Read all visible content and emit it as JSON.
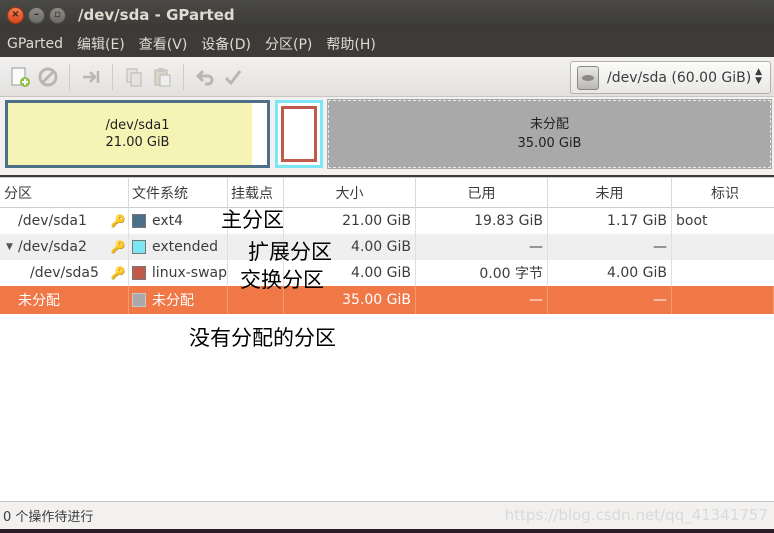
{
  "window": {
    "title": "/dev/sda - GParted",
    "close_glyph": "×",
    "min_glyph": "–",
    "max_glyph": "▫"
  },
  "menu": [
    "GParted",
    "编辑(E)",
    "查看(V)",
    "设备(D)",
    "分区(P)",
    "帮助(H)"
  ],
  "toolbar": {
    "icons": [
      "new-partition-icon",
      "delete-icon",
      "resize-move-icon",
      "copy-icon",
      "paste-icon",
      "undo-icon",
      "apply-icon"
    ],
    "device_selector": "/dev/sda   (60.00 GiB)"
  },
  "map": {
    "sda1_label": "/dev/sda1",
    "sda1_size": "21.00 GiB",
    "sda1_used_fraction": 0.944,
    "unalloc_label": "未分配",
    "unalloc_size": "35.00 GiB"
  },
  "table": {
    "headers": [
      "分区",
      "文件系统",
      "挂载点",
      "大小",
      "已用",
      "未用",
      "标识"
    ],
    "rows": [
      {
        "partition": "/dev/sda1",
        "filesystem": "ext4",
        "color": "#4d6f88",
        "mount": "",
        "size": "21.00 GiB",
        "used": "19.83 GiB",
        "unused": "1.17 GiB",
        "flags": "boot"
      },
      {
        "partition": "/dev/sda2",
        "filesystem": "extended",
        "color": "#7de6f3",
        "mount": "",
        "size": "4.00 GiB",
        "used": "—",
        "unused": "—",
        "flags": ""
      },
      {
        "partition": "/dev/sda5",
        "filesystem": "linux-swap",
        "color": "#c15a4b",
        "mount": "",
        "size": "4.00 GiB",
        "used": "0.00 字节",
        "unused": "4.00 GiB",
        "flags": ""
      },
      {
        "partition": "未分配",
        "filesystem": "未分配",
        "color": "#a9a9a9",
        "mount": "",
        "size": "35.00 GiB",
        "used": "—",
        "unused": "—",
        "flags": ""
      }
    ]
  },
  "annotations": {
    "primary": "主分区",
    "extended": "扩展分区",
    "swap": "交换分区",
    "unallocated": "没有分配的分区"
  },
  "status": {
    "text": "0 个操作待进行",
    "watermark": "https://blog.csdn.net/qq_41341757"
  },
  "colors": {
    "selection": "#f07746",
    "ext4": "#4d6f88",
    "extended": "#7de6f3",
    "swap": "#c15a4b",
    "unallocated": "#a9a9a9"
  }
}
